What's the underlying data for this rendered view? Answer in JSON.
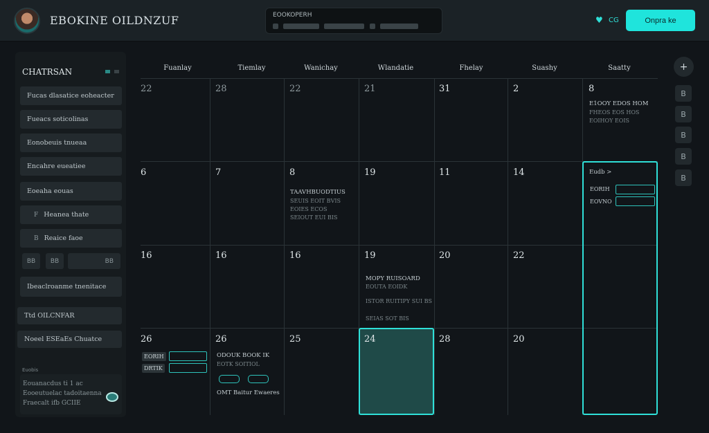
{
  "header": {
    "app_title": "EBOKINE OILDNZUF",
    "search_label": "EOOKOPERH",
    "status_text": "CG",
    "primary_button": "Onpra ke"
  },
  "sidebar": {
    "title": "CHATRSAN",
    "items": [
      {
        "label": "Fucas dlasatice  eoheacter",
        "icon": ""
      },
      {
        "label": "Fueacs soticolinas",
        "icon": ""
      },
      {
        "label": "Eonobeuis tnueaa",
        "icon": ""
      },
      {
        "label": "Encahre eueatiee",
        "icon": ""
      },
      {
        "label": "Eoeaha eouas",
        "icon": ""
      },
      {
        "label": "Heanea thate",
        "icon": "F"
      },
      {
        "label": "Reaice faoe",
        "icon": "B"
      }
    ],
    "chips": [
      "BB",
      "BB",
      "BB"
    ],
    "items2": [
      {
        "label": "Ibeaclroanme  tnenitace"
      },
      {
        "label": "Ttd OILCNFAR"
      },
      {
        "label": "Noeel ESEaEs Chuatce"
      }
    ],
    "footer_label": "Euobis",
    "footer_lines": [
      "Eouanacdus ti 1 ac",
      "Eooeutuelac tadoitaenna",
      "Fraecalt ifb GCIIE"
    ]
  },
  "calendar": {
    "days": [
      "Fuanlay",
      "Tiemlay",
      "Wanichay",
      "Wlandatie",
      "Fhelay",
      "Suashy",
      "Saatty"
    ],
    "weeks": [
      [
        "22",
        "28",
        "22",
        "21",
        "31",
        "2",
        "8"
      ],
      [
        "6",
        "7",
        "8",
        "19",
        "11",
        "14",
        ""
      ],
      [
        "16",
        "16",
        "16",
        "19",
        "20",
        "22",
        ""
      ],
      [
        "26",
        "26",
        "25",
        "24",
        "28",
        "20",
        ""
      ]
    ],
    "events": {
      "sat_w1_title": "E1OOY EDOS HOM",
      "sat_w1_l1": "FHEOS  EOS  HOS",
      "sat_w1_l2": "EOIHOY  EOIS",
      "sat_w2_head": "Eudb >",
      "sat_w2_r1": "EORIH",
      "sat_w2_r2": "EOVNO",
      "wed_w2_title": "TAAVHBUODTIUS",
      "wed_w2_l1": "SEUIS  EOIT  BVIS",
      "wed_w2_l2": "EOIES  ECOS",
      "wed_w2_l3": "SEIOUT  EUI  BIS",
      "thu_w3_title": "MOPY RUISOARD",
      "thu_w3_l1": "EOUTA  EOIDK",
      "thu_w3_l2": "ISTOR RUITIPY SUI BS",
      "thu_w3_l3": "SEIAS  SOT  BIS",
      "mon_w4_r1": "EORIH",
      "mon_w4_r2": "DRTIK",
      "tue_w4_title": "ODOUK BOOK IK",
      "tue_w4_l1": "EOTK  SOITIOL",
      "tue_w4_foot": "OMT Baitur Ewaeres"
    }
  },
  "rail": {
    "add": "+",
    "buttons": [
      "B",
      "B",
      "B",
      "B",
      "B"
    ]
  },
  "colors": {
    "accent": "#1fe4dc",
    "today_fill": "#1f4a48"
  }
}
